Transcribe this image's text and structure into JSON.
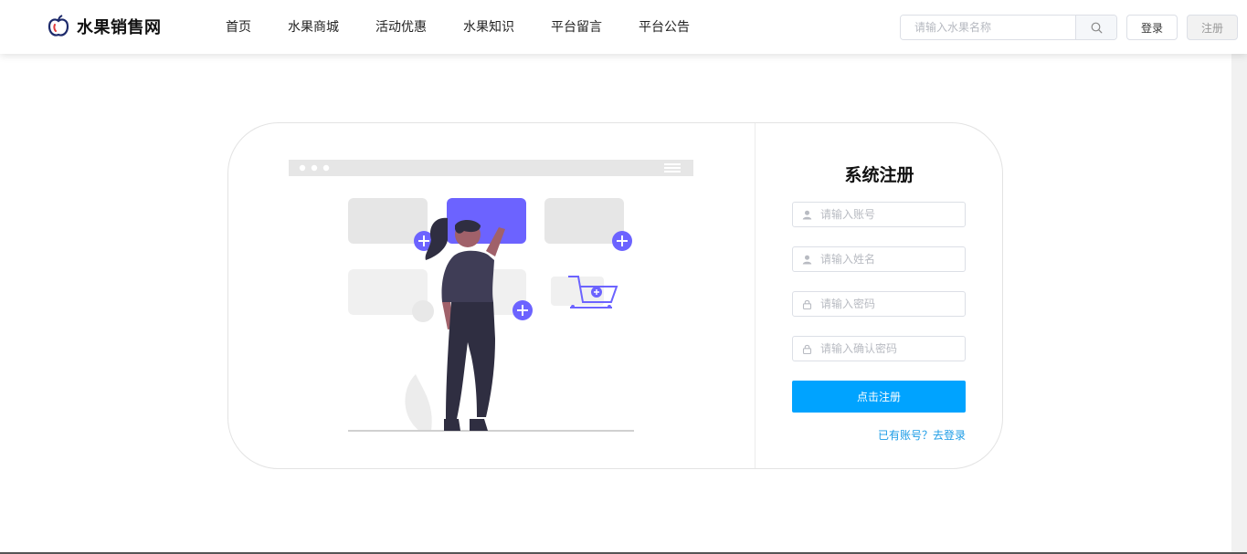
{
  "header": {
    "logo_text": "水果销售网",
    "nav": [
      "首页",
      "水果商城",
      "活动优惠",
      "水果知识",
      "平台留言",
      "平台公告"
    ],
    "search_placeholder": "请输入水果名称",
    "login_label": "登录",
    "register_label": "注册"
  },
  "form": {
    "title": "系统注册",
    "account_placeholder": "请输入账号",
    "name_placeholder": "请输入姓名",
    "password_placeholder": "请输入密码",
    "confirm_placeholder": "请输入确认密码",
    "submit_label": "点击注册",
    "login_link": "已有账号？去登录"
  },
  "colors": {
    "accent_purple": "#6c63ff",
    "primary_blue": "#00a3ff",
    "link_blue": "#1a9be6"
  }
}
